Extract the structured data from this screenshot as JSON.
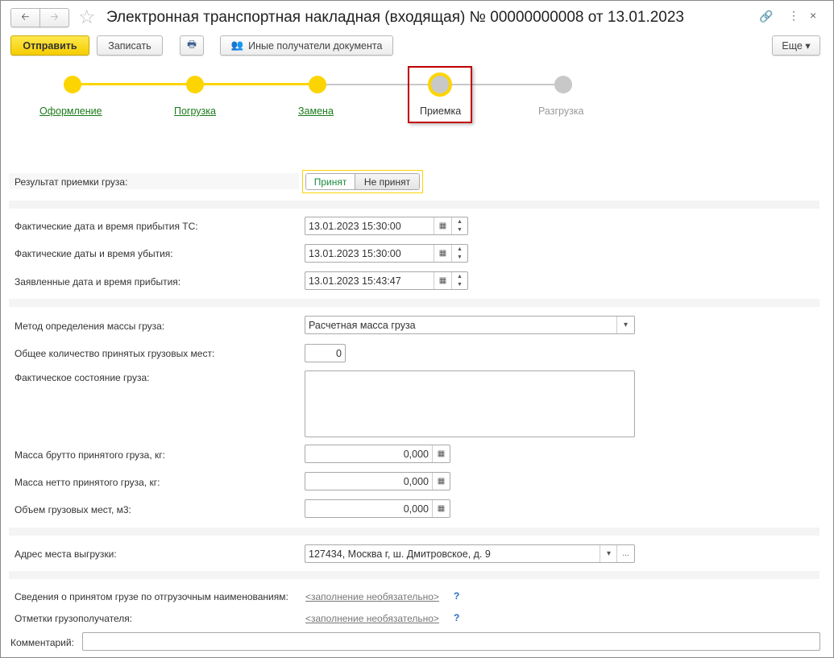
{
  "header": {
    "title": "Электронная транспортная накладная (входящая) № 00000000008 от 13.01.2023"
  },
  "toolbar": {
    "send": "Отправить",
    "save": "Записать",
    "other_recipients": "Иные получатели документа",
    "more": "Еще"
  },
  "steps": [
    {
      "label": "Оформление",
      "state": "done"
    },
    {
      "label": "Погрузка",
      "state": "done"
    },
    {
      "label": "Замена",
      "state": "done"
    },
    {
      "label": "Приемка",
      "state": "current"
    },
    {
      "label": "Разгрузка",
      "state": "pending"
    }
  ],
  "colors": {
    "accent": "#fcd500",
    "link": "#1a7a1a",
    "highlight": "#c00000"
  },
  "form": {
    "result_label": "Результат приемки груза:",
    "accepted": "Принят",
    "not_accepted": "Не принят",
    "arrival_label": "Фактические дата и время прибытия ТС:",
    "arrival": "13.01.2023 15:30:00",
    "departure_label": "Фактические даты и время убытия:",
    "departure": "13.01.2023 15:30:00",
    "declared_label": "Заявленные дата и время прибытия:",
    "declared": "13.01.2023 15:43:47",
    "method_label": "Метод определения массы груза:",
    "method": "Расчетная масса груза",
    "places_label": "Общее количество принятых грузовых мест:",
    "places": "0",
    "state_label": "Фактическое состояние груза:",
    "state": "",
    "gross_label": "Масса брутто принятого груза, кг:",
    "gross": "0,000",
    "net_label": "Масса нетто принятого груза, кг:",
    "net": "0,000",
    "volume_label": "Объем грузовых мест, м3:",
    "volume": "0,000",
    "address_label": "Адрес места выгрузки:",
    "address": "127434, Москва г, ш. Дмитровское, д. 9",
    "cargo_info_label": "Сведения о принятом грузе по отгрузочным наименованиям:",
    "optional1": "<заполнение необязательно>",
    "consignee_label": "Отметки грузополучателя:",
    "optional2": "<заполнение необязательно>",
    "help": "?",
    "comment_label": "Комментарий:",
    "comment": ""
  }
}
